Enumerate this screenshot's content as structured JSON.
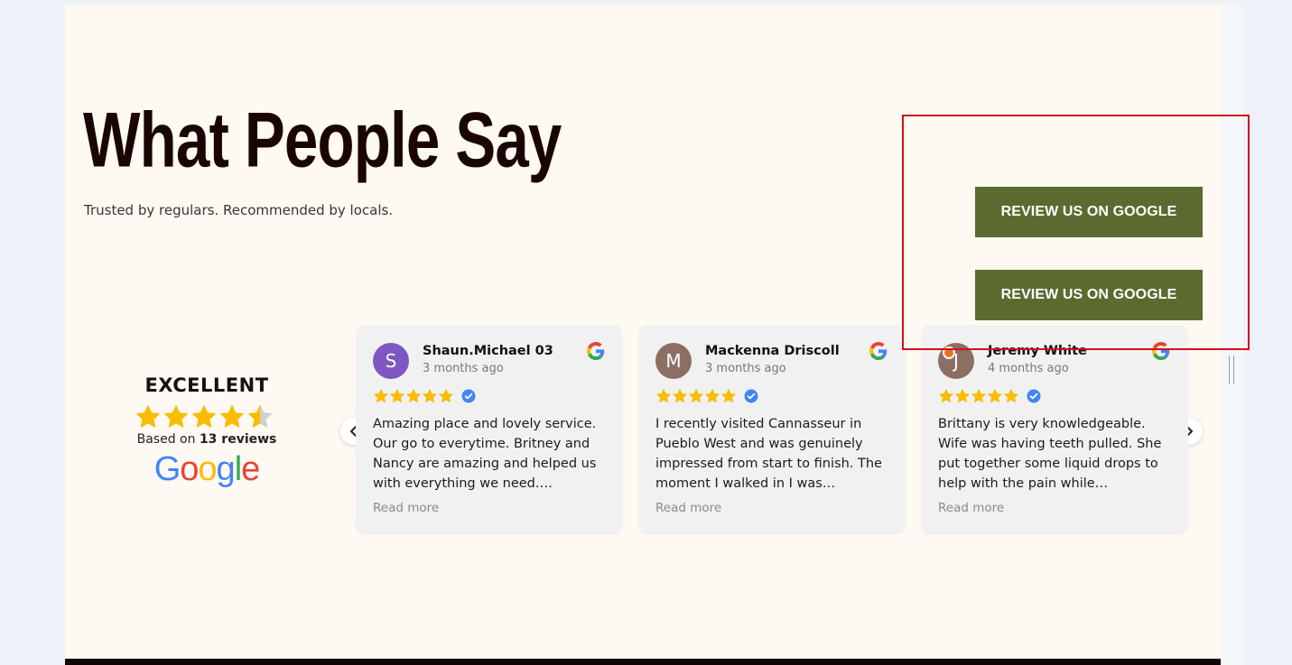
{
  "section": {
    "heading": "What People Say",
    "subtitle": "Trusted by regulars. Recommended by locals."
  },
  "buttons": {
    "review_primary": "REVIEW US ON GOOGLE",
    "review_secondary": "REVIEW US ON GOOGLE"
  },
  "summary": {
    "rating_label": "EXCELLENT",
    "stars": 4.5,
    "based_on": "Based on",
    "count": "13 reviews",
    "google_logo": "Google"
  },
  "reviews": [
    {
      "name": "Shaun.Michael 03",
      "date": "3 months ago",
      "avatar_letter": "S",
      "avatar_color": "#7e57c2",
      "stars": 5,
      "text": "Amazing place and lovely service. Our go to everytime. Britney and Nancy are amazing and helped us with everything we need.…",
      "read_more": "Read more"
    },
    {
      "name": "Mackenna Driscoll",
      "date": "3 months ago",
      "avatar_letter": "M",
      "avatar_color": "#8d6e63",
      "stars": 5,
      "text": "I recently visited Cannasseur in Pueblo West and was genuinely impressed from start to finish. The moment I walked in I was…",
      "read_more": "Read more"
    },
    {
      "name": "Jeremy White",
      "date": "4 months ago",
      "avatar_letter": "J",
      "avatar_color": "#8d6e63",
      "stars": 5,
      "text": "Brittany is very knowledgeable. Wife was having teeth pulled. She put together some liquid drops to help with the pain while…",
      "read_more": "Read more"
    }
  ],
  "icons": {
    "prev": "chevron-left-icon",
    "next": "chevron-right-icon",
    "google_mark": "google-g-icon",
    "verified": "verified-badge-icon",
    "star": "star-icon"
  },
  "colors": {
    "page_bg": "#fef9f3",
    "button_bg": "#5b6b2f",
    "star": "#fbbc04",
    "card_bg": "#f1f1f1",
    "highlight": "#d0121b"
  }
}
